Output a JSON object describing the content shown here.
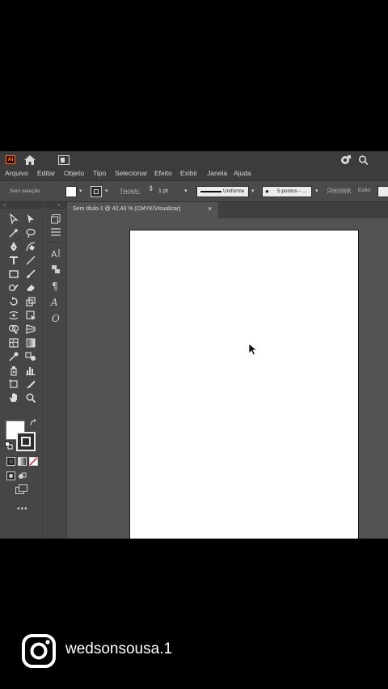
{
  "app": {
    "logo_text": "Ai",
    "brand_color": "#ff7c00"
  },
  "titlebar": {
    "icons": [
      "home-icon",
      "workspace-icon",
      "share-icon",
      "search-icon"
    ]
  },
  "menu": {
    "items": [
      "Arquivo",
      "Editar",
      "Objeto",
      "Tipo",
      "Selecionar",
      "Efeito",
      "Exibir",
      "Janela",
      "Ajuda"
    ]
  },
  "control_bar": {
    "selection_text": "Sem seleção",
    "stroke_label": "Traçado:",
    "stroke_weight": "1 pt",
    "profile": "Uniforme",
    "brush": "5 pontos - ...",
    "opacity_label": "Opacidade",
    "style_label": "Estilo:"
  },
  "document": {
    "tab_title": "Sem título-1 @ 42,43 % (CMYK/Visualizar)",
    "close_symbol": "×"
  },
  "watermark": {
    "handle": "wedsonsousa.1"
  }
}
